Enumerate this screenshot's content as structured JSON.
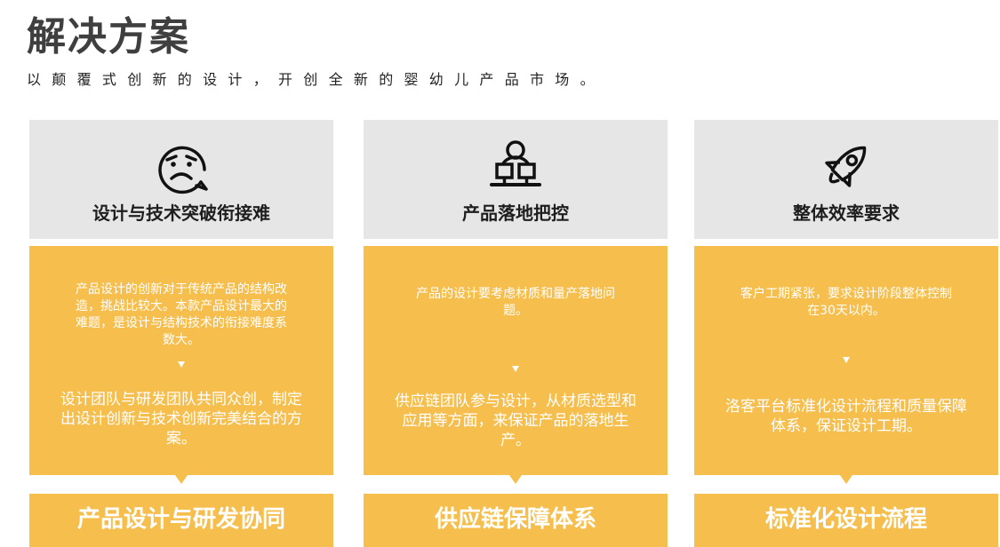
{
  "page": {
    "title": "解决方案",
    "subtitle": "以颠覆式创新的设计，开创全新的婴幼儿产品市场。"
  },
  "columns": [
    {
      "icon": "sad-face-icon",
      "title": "设计与技术突破衔接难",
      "problem": "产品设计的创新对于传统产品的结构改造，挑战比较大。本款产品设计最大的难题，是设计与结构技术的衔接难度系数大。",
      "solution": "设计团队与研发团队共同众创，制定出设计创新与技术创新完美结合的方案。",
      "footer": "产品设计与研发协同"
    },
    {
      "icon": "person-at-computer-icon",
      "title": "产品落地把控",
      "problem": "产品的设计要考虑材质和量产落地问题。",
      "solution": "供应链团队参与设计，从材质选型和应用等方面，来保证产品的落地生产。",
      "footer": "供应链保障体系"
    },
    {
      "icon": "rocket-icon",
      "title": "整体效率要求",
      "problem": "客户工期紧张，要求设计阶段整体控制在30天以内。",
      "solution": "洛客平台标准化设计流程和质量保障体系，保证设计工期。",
      "footer": "标准化设计流程"
    }
  ],
  "colors": {
    "accent": "#f6be4c",
    "header_bg": "#e6e6e6",
    "title_text": "#3f3f3f"
  }
}
